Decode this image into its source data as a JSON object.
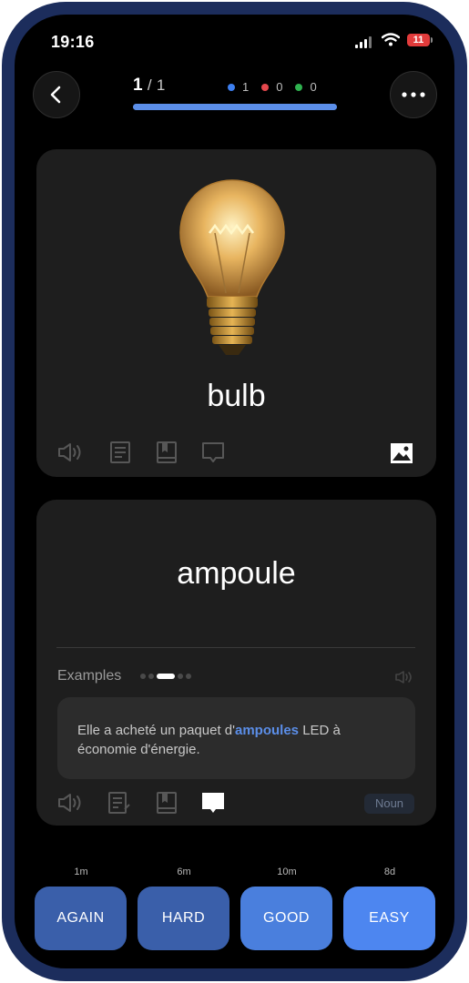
{
  "status_bar": {
    "time": "19:16",
    "battery": "11"
  },
  "header": {
    "current": "1",
    "separator": "/",
    "total": "1",
    "progress": 1.0,
    "stats": [
      {
        "color": "#3d7ff0",
        "count": "1"
      },
      {
        "color": "#e5484d",
        "count": "0"
      },
      {
        "color": "#2fb24f",
        "count": "0"
      }
    ]
  },
  "front": {
    "word": "bulb",
    "image": "light-bulb"
  },
  "back": {
    "word": "ampoule",
    "examples_label": "Examples",
    "example": {
      "before": "Elle a acheté un paquet d'",
      "highlight": "ampoules",
      "after": " LED à économie d'énergie."
    },
    "part_of_speech": "Noun"
  },
  "answers": [
    {
      "label": "AGAIN",
      "interval": "1m",
      "color": "#3a5faa"
    },
    {
      "label": "HARD",
      "interval": "6m",
      "color": "#3a5faa"
    },
    {
      "label": "GOOD",
      "interval": "10m",
      "color": "#4a7fdd"
    },
    {
      "label": "EASY",
      "interval": "8d",
      "color": "#4d86f0"
    }
  ],
  "icons": [
    "back-arrow-icon",
    "more-icon",
    "speaker-icon",
    "note-icon",
    "book-icon",
    "comment-icon",
    "image-icon"
  ]
}
